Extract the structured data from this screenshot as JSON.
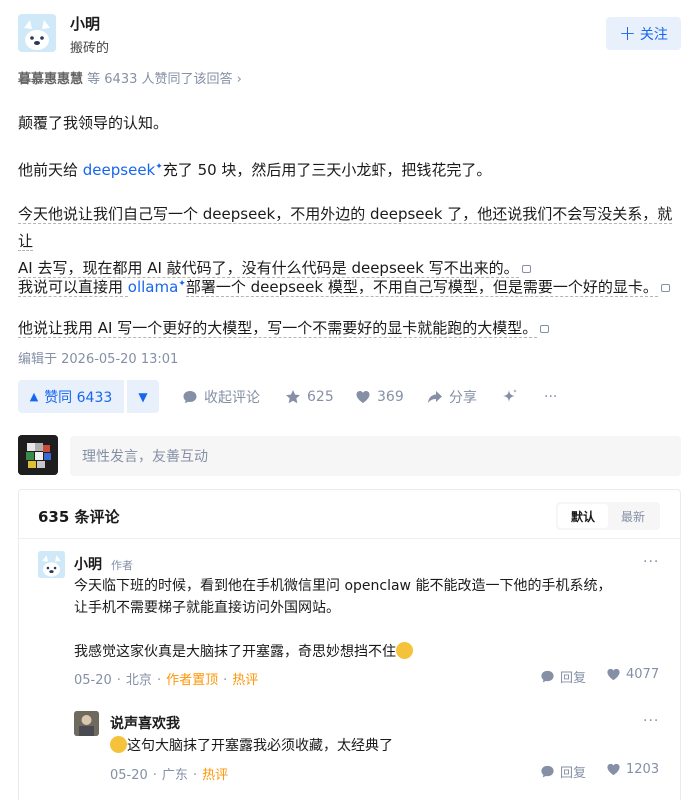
{
  "author": {
    "name": "小明",
    "bio": "搬砖的"
  },
  "follow": {
    "label": "关注"
  },
  "endorse": {
    "names": "暮慕惠惠慧",
    "rest": " 等 6433 人赞同了该回答 ›"
  },
  "content": {
    "p1": "颠覆了我领导的认知。",
    "p2_a": "他前天给 ",
    "p2_link": "deepseek",
    "p2_b": "充了 50 块，然后用了三天小龙虾，把钱花完了。",
    "p3_l1": "今天他说让我们自己写一个 deepseek，不用外边的 deepseek 了，他还说我们不会写没关系，就让",
    "p3_l2": "AI 去写，现在都用 AI 敲代码了，没有什么代码是 deepseek 写不出来的。",
    "p4_a": "我说可以直接用 ",
    "p4_link": "ollama",
    "p4_b": "部署一个 deepseek 模型，不用自己写模型，但是需要一个好的显卡。",
    "p5": "他说让我用 AI 写一个更好的大模型，写一个不需要好的显卡就能跑的大模型。"
  },
  "edited": "编辑于 2026-05-20 13:01",
  "actions": {
    "vote_label": "赞同 6433",
    "collapse": "收起评论",
    "favorites": "625",
    "likes": "369",
    "share": "分享",
    "more": "···"
  },
  "comment_input": {
    "placeholder": "理性发言，友善互动"
  },
  "comments": {
    "count": "635 条评论",
    "sort": [
      "默认",
      "最新"
    ],
    "c1": {
      "name": "小明",
      "tag": "作者",
      "line1": "今天临下班的时候，看到他在手机微信里问 openclaw 能不能改造一下他的手机系统，",
      "line2": "让手机不需要梯子就能直接访问外国网站。",
      "line3": "我感觉这家伙真是大脑抹了开塞露，奇思妙想挡不住",
      "date": "05-20",
      "location": "北京",
      "badge1": "作者置顶",
      "badge2": "热评",
      "reply": "回复",
      "likes": "4077"
    },
    "c2": {
      "name": "说声喜欢我",
      "text": "这句大脑抹了开塞露我必须收藏，太经典了",
      "date": "05-20",
      "location": "广东",
      "badge": "热评",
      "reply": "回复",
      "likes": "1203"
    },
    "more": "···"
  },
  "colors": {
    "brand": "#1766ef",
    "muted": "#8590a6",
    "hot": "#ff9607"
  }
}
